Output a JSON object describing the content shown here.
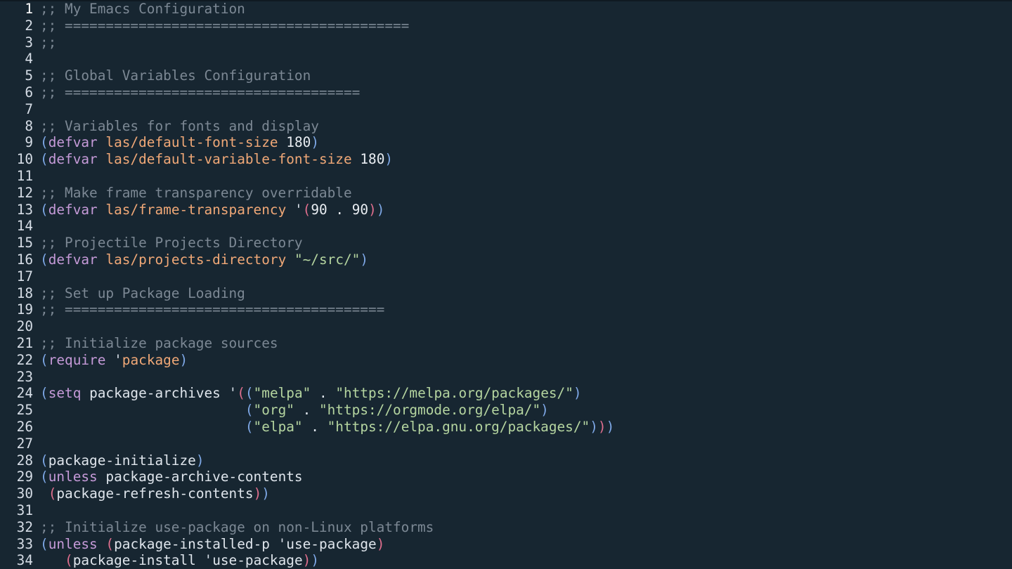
{
  "editor": {
    "colors": {
      "background": "#172631",
      "comment": "#7c8894",
      "keyword": "#c59ad8",
      "variable": "#f0a877",
      "string": "#b5d5a0",
      "text": "#dfe5ec",
      "paren_outer": "#7fa9e8",
      "paren_inner": "#e16f8e"
    },
    "lines": [
      {
        "n": "1",
        "tokens": [
          {
            "c": "comment",
            "t": ";; My Emacs Configuration"
          }
        ]
      },
      {
        "n": "2",
        "tokens": [
          {
            "c": "comment",
            "t": ";; =========================================="
          }
        ]
      },
      {
        "n": "3",
        "tokens": [
          {
            "c": "comment",
            "t": ";;"
          }
        ]
      },
      {
        "n": "4",
        "tokens": []
      },
      {
        "n": "5",
        "tokens": [
          {
            "c": "comment",
            "t": ";; Global Variables Configuration"
          }
        ]
      },
      {
        "n": "6",
        "tokens": [
          {
            "c": "comment",
            "t": ";; ===================================="
          }
        ]
      },
      {
        "n": "7",
        "tokens": []
      },
      {
        "n": "8",
        "tokens": [
          {
            "c": "comment",
            "t": ";; Variables for fonts and display"
          }
        ]
      },
      {
        "n": "9",
        "tokens": [
          {
            "c": "paren1",
            "t": "("
          },
          {
            "c": "keyword",
            "t": "defvar"
          },
          {
            "c": "plain",
            "t": " "
          },
          {
            "c": "var",
            "t": "las/default-font-size"
          },
          {
            "c": "plain",
            "t": " "
          },
          {
            "c": "number",
            "t": "180"
          },
          {
            "c": "paren1",
            "t": ")"
          }
        ]
      },
      {
        "n": "10",
        "tokens": [
          {
            "c": "paren1",
            "t": "("
          },
          {
            "c": "keyword",
            "t": "defvar"
          },
          {
            "c": "plain",
            "t": " "
          },
          {
            "c": "var",
            "t": "las/default-variable-font-size"
          },
          {
            "c": "plain",
            "t": " "
          },
          {
            "c": "number",
            "t": "180"
          },
          {
            "c": "paren1",
            "t": ")"
          }
        ]
      },
      {
        "n": "11",
        "tokens": []
      },
      {
        "n": "12",
        "tokens": [
          {
            "c": "comment",
            "t": ";; Make frame transparency overridable"
          }
        ]
      },
      {
        "n": "13",
        "tokens": [
          {
            "c": "paren1",
            "t": "("
          },
          {
            "c": "keyword",
            "t": "defvar"
          },
          {
            "c": "plain",
            "t": " "
          },
          {
            "c": "var",
            "t": "las/frame-transparency"
          },
          {
            "c": "plain",
            "t": " "
          },
          {
            "c": "quote",
            "t": "'"
          },
          {
            "c": "paren2",
            "t": "("
          },
          {
            "c": "number",
            "t": "90 . 90"
          },
          {
            "c": "paren2",
            "t": ")"
          },
          {
            "c": "paren1",
            "t": ")"
          }
        ]
      },
      {
        "n": "14",
        "tokens": []
      },
      {
        "n": "15",
        "tokens": [
          {
            "c": "comment",
            "t": ";; Projectile Projects Directory"
          }
        ]
      },
      {
        "n": "16",
        "tokens": [
          {
            "c": "paren1",
            "t": "("
          },
          {
            "c": "keyword",
            "t": "defvar"
          },
          {
            "c": "plain",
            "t": " "
          },
          {
            "c": "var",
            "t": "las/projects-directory"
          },
          {
            "c": "plain",
            "t": " "
          },
          {
            "c": "string",
            "t": "\"~/src/\""
          },
          {
            "c": "paren1",
            "t": ")"
          }
        ]
      },
      {
        "n": "17",
        "tokens": []
      },
      {
        "n": "18",
        "tokens": [
          {
            "c": "comment",
            "t": ";; Set up Package Loading"
          }
        ]
      },
      {
        "n": "19",
        "tokens": [
          {
            "c": "comment",
            "t": ";; ======================================="
          }
        ]
      },
      {
        "n": "20",
        "tokens": []
      },
      {
        "n": "21",
        "tokens": [
          {
            "c": "comment",
            "t": ";; Initialize package sources"
          }
        ]
      },
      {
        "n": "22",
        "tokens": [
          {
            "c": "paren1",
            "t": "("
          },
          {
            "c": "keyword",
            "t": "require"
          },
          {
            "c": "plain",
            "t": " "
          },
          {
            "c": "quote",
            "t": "'"
          },
          {
            "c": "var",
            "t": "package"
          },
          {
            "c": "paren1",
            "t": ")"
          }
        ]
      },
      {
        "n": "23",
        "tokens": []
      },
      {
        "n": "24",
        "tokens": [
          {
            "c": "paren1",
            "t": "("
          },
          {
            "c": "keyword",
            "t": "setq"
          },
          {
            "c": "plain",
            "t": " package-archives "
          },
          {
            "c": "quote",
            "t": "'"
          },
          {
            "c": "paren2",
            "t": "("
          },
          {
            "c": "paren1",
            "t": "("
          },
          {
            "c": "string",
            "t": "\"melpa\""
          },
          {
            "c": "plain",
            "t": " . "
          },
          {
            "c": "string",
            "t": "\"https://melpa.org/packages/\""
          },
          {
            "c": "paren1",
            "t": ")"
          }
        ]
      },
      {
        "n": "25",
        "tokens": [
          {
            "c": "plain",
            "t": "                         "
          },
          {
            "c": "paren1",
            "t": "("
          },
          {
            "c": "string",
            "t": "\"org\""
          },
          {
            "c": "plain",
            "t": " . "
          },
          {
            "c": "string",
            "t": "\"https://orgmode.org/elpa/\""
          },
          {
            "c": "paren1",
            "t": ")"
          }
        ]
      },
      {
        "n": "26",
        "tokens": [
          {
            "c": "plain",
            "t": "                         "
          },
          {
            "c": "paren1",
            "t": "("
          },
          {
            "c": "string",
            "t": "\"elpa\""
          },
          {
            "c": "plain",
            "t": " . "
          },
          {
            "c": "string",
            "t": "\"https://elpa.gnu.org/packages/\""
          },
          {
            "c": "paren1",
            "t": ")"
          },
          {
            "c": "paren2",
            "t": ")"
          },
          {
            "c": "paren1",
            "t": ")"
          }
        ]
      },
      {
        "n": "27",
        "tokens": []
      },
      {
        "n": "28",
        "tokens": [
          {
            "c": "paren1",
            "t": "("
          },
          {
            "c": "plain",
            "t": "package-initialize"
          },
          {
            "c": "paren1",
            "t": ")"
          }
        ]
      },
      {
        "n": "29",
        "tokens": [
          {
            "c": "paren1",
            "t": "("
          },
          {
            "c": "keyword",
            "t": "unless"
          },
          {
            "c": "plain",
            "t": " package-archive-contents"
          }
        ]
      },
      {
        "n": "30",
        "tokens": [
          {
            "c": "plain",
            "t": " "
          },
          {
            "c": "paren2",
            "t": "("
          },
          {
            "c": "plain",
            "t": "package-refresh-contents"
          },
          {
            "c": "paren2",
            "t": ")"
          },
          {
            "c": "paren1",
            "t": ")"
          }
        ]
      },
      {
        "n": "31",
        "tokens": []
      },
      {
        "n": "32",
        "tokens": [
          {
            "c": "comment",
            "t": ";; Initialize use-package on non-Linux platforms"
          }
        ]
      },
      {
        "n": "33",
        "tokens": [
          {
            "c": "paren1",
            "t": "("
          },
          {
            "c": "keyword",
            "t": "unless"
          },
          {
            "c": "plain",
            "t": " "
          },
          {
            "c": "paren2",
            "t": "("
          },
          {
            "c": "plain",
            "t": "package-installed-p "
          },
          {
            "c": "quote",
            "t": "'"
          },
          {
            "c": "plain",
            "t": "use-package"
          },
          {
            "c": "paren2",
            "t": ")"
          }
        ]
      },
      {
        "n": "34",
        "tokens": [
          {
            "c": "plain",
            "t": "   "
          },
          {
            "c": "paren2",
            "t": "("
          },
          {
            "c": "plain",
            "t": "package-install "
          },
          {
            "c": "quote",
            "t": "'"
          },
          {
            "c": "plain",
            "t": "use-package"
          },
          {
            "c": "paren2",
            "t": ")"
          },
          {
            "c": "paren1",
            "t": ")"
          }
        ]
      }
    ]
  }
}
